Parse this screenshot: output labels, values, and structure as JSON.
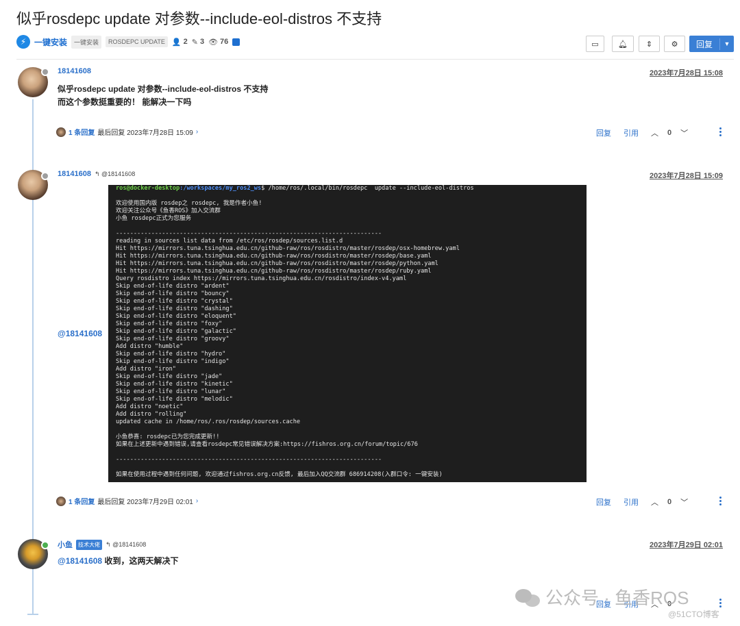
{
  "topic": {
    "title": "似乎rosdepc update 对参数--include-eol-distros 不支持",
    "category": "一键安装",
    "tags": [
      "一键安装",
      "ROSDEPC UPDATE"
    ],
    "posters": "2",
    "posts": "3",
    "views": "76"
  },
  "toolbar": {
    "reply_label": "回复"
  },
  "posts": [
    {
      "author": "18141608",
      "timestamp": "2023年7月28日 15:08",
      "body_line1": "似乎rosdepc update 对参数--include-eol-distros 不支持",
      "body_line2": "而这个参数挺重要的！ 能解决一下吗",
      "replies_count": "1 条回复",
      "last_reply": "最后回复 2023年7月28日 15:09",
      "votes": "0"
    },
    {
      "author": "18141608",
      "reply_to": "@18141608",
      "timestamp": "2023年7月28日 15:09",
      "mention": "@18141608",
      "replies_count": "1 条回复",
      "last_reply": "最后回复 2023年7月29日 02:01",
      "votes": "0"
    },
    {
      "author": "小鱼",
      "badge": "技术大佬",
      "reply_to": "@18141608",
      "timestamp": "2023年7月29日 02:01",
      "mention": "@18141608",
      "body": "收到，这两天解决下",
      "votes": "0"
    }
  ],
  "actions": {
    "reply": "回复",
    "quote": "引用"
  },
  "terminal": {
    "prompt_user": "ros@docker-desktop",
    "prompt_path": ":/workspaces/my_ros2_ws",
    "command": "$ /home/ros/.local/bin/rosdepc  update --include-eol-distros",
    "lines": [
      "",
      "欢迎使用国内版 rosdep之 rosdepc, 我是作者小鱼!",
      "欢迎关注公众号《鱼香ROS》加入交流群",
      "小鱼 rosdepc正式为您服务",
      "",
      "---------------------------------------------------------------------------",
      "reading in sources list data from /etc/ros/rosdep/sources.list.d",
      "Hit https://mirrors.tuna.tsinghua.edu.cn/github-raw/ros/rosdistro/master/rosdep/osx-homebrew.yaml",
      "Hit https://mirrors.tuna.tsinghua.edu.cn/github-raw/ros/rosdistro/master/rosdep/base.yaml",
      "Hit https://mirrors.tuna.tsinghua.edu.cn/github-raw/ros/rosdistro/master/rosdep/python.yaml",
      "Hit https://mirrors.tuna.tsinghua.edu.cn/github-raw/ros/rosdistro/master/rosdep/ruby.yaml",
      "Query rosdistro index https://mirrors.tuna.tsinghua.edu.cn/rosdistro/index-v4.yaml",
      "Skip end-of-life distro \"ardent\"",
      "Skip end-of-life distro \"bouncy\"",
      "Skip end-of-life distro \"crystal\"",
      "Skip end-of-life distro \"dashing\"",
      "Skip end-of-life distro \"eloquent\"",
      "Skip end-of-life distro \"foxy\"",
      "Skip end-of-life distro \"galactic\"",
      "Skip end-of-life distro \"groovy\"",
      "Add distro \"humble\"",
      "Skip end-of-life distro \"hydro\"",
      "Skip end-of-life distro \"indigo\"",
      "Add distro \"iron\"",
      "Skip end-of-life distro \"jade\"",
      "Skip end-of-life distro \"kinetic\"",
      "Skip end-of-life distro \"lunar\"",
      "Skip end-of-life distro \"melodic\"",
      "Add distro \"noetic\"",
      "Add distro \"rolling\"",
      "updated cache in /home/ros/.ros/rosdep/sources.cache",
      "",
      "小鱼恭喜: rosdepc已为您完成更新!!",
      "如果在上述更新中遇到错误,请查看rosdepc常见错误解决方案:https://fishros.org.cn/forum/topic/676",
      "",
      "---------------------------------------------------------------------------",
      "",
      "如果在使用过程中遇到任何问题, 欢迎通过fishros.org.cn反馈, 最后加入QQ交流群 686914208(入群口令: 一键安装)"
    ]
  },
  "watermark": {
    "main": "公众号 · 鱼香ROS",
    "corner": "@51CTO博客"
  },
  "colors": {
    "accent": "#3a7fd5",
    "link": "#2a6fc9",
    "terminal_bg": "#1e1e1e",
    "offline": "#9e9e9e",
    "online": "#4caf50"
  }
}
